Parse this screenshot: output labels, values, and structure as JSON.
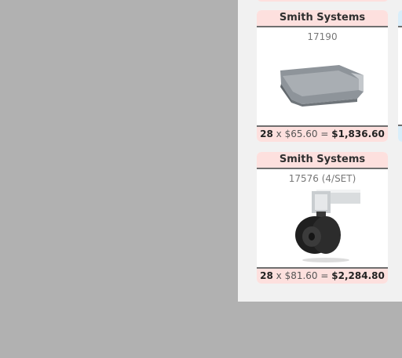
{
  "products": [
    {
      "brand": "Smith Systems",
      "sku": "17190",
      "quantity": "28",
      "times": "x",
      "unit_price": "$65.60",
      "equals": "=",
      "total": "$1,836.60",
      "image_icon": "letter-tray-icon"
    },
    {
      "brand": "Smith Systems",
      "sku": "17576 (4/SET)",
      "quantity": "28",
      "times": "x",
      "unit_price": "$81.60",
      "equals": "=",
      "total": "$2,284.80",
      "image_icon": "caster-wheel-icon"
    }
  ],
  "colors": {
    "backdrop": "#b1b1b1",
    "panel": "#f1f1f1",
    "card_band": "#fde0de",
    "card_band_alt": "#d9eefa",
    "divider": "#6f6f6f"
  }
}
